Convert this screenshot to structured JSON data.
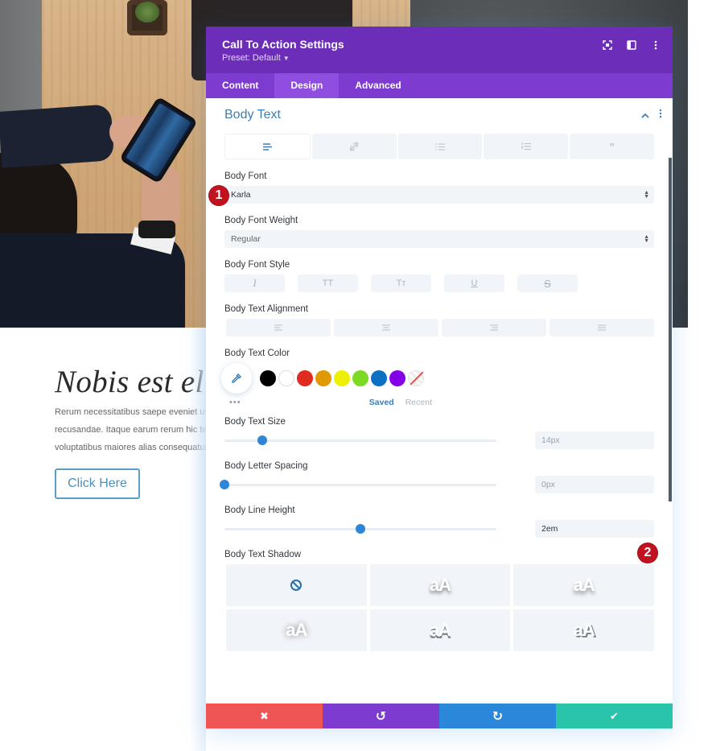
{
  "page": {
    "cta_title": "Nobis est eligendi",
    "cta_body_lines": [
      "Rerum necessitatibus saepe eveniet ut",
      "recusandae. Itaque earum rerum hic tenetur",
      "voluptatibus maiores alias consequatur"
    ],
    "cta_button": "Click Here"
  },
  "modal": {
    "title": "Call To Action Settings",
    "preset": "Preset: Default",
    "header_icons": [
      "fullscreen-icon",
      "sidebar-icon",
      "more-icon"
    ],
    "tabs": [
      {
        "label": "Content",
        "active": false
      },
      {
        "label": "Design",
        "active": true
      },
      {
        "label": "Advanced",
        "active": false
      }
    ],
    "section": {
      "title": "Body Text",
      "subtabs": [
        "paragraph-icon",
        "link-icon",
        "unordered-list-icon",
        "ordered-list-icon",
        "quote-icon"
      ],
      "active_subtab": 0
    },
    "fields": {
      "body_font": {
        "label": "Body Font",
        "value": "Karla"
      },
      "body_font_weight": {
        "label": "Body Font Weight",
        "value": "Regular"
      },
      "body_font_style": {
        "label": "Body Font Style",
        "options": [
          "I",
          "TT",
          "Tт",
          "U",
          "S"
        ]
      },
      "body_text_alignment": {
        "label": "Body Text Alignment",
        "options": [
          "left",
          "center",
          "right",
          "justify"
        ]
      },
      "body_text_color": {
        "label": "Body Text Color",
        "swatches": [
          "#000000",
          "#ffffff",
          "#e02b20",
          "#e09900",
          "#edf000",
          "#7cda24",
          "#0c71c3",
          "#8300e9",
          "none"
        ],
        "tabs": {
          "saved": "Saved",
          "recent": "Recent"
        },
        "more": "•••"
      },
      "body_text_size": {
        "label": "Body Text Size",
        "value": "14px",
        "slider_fraction": 0.14
      },
      "body_letter_spacing": {
        "label": "Body Letter Spacing",
        "value": "0px",
        "slider_fraction": 0.0
      },
      "body_line_height": {
        "label": "Body Line Height",
        "value": "2em",
        "slider_fraction": 0.5
      },
      "body_text_shadow": {
        "label": "Body Text Shadow",
        "sample": "aA",
        "presets": 6
      }
    },
    "badges": {
      "one": "1",
      "two": "2"
    },
    "footer": {
      "cancel": {
        "icon": "✖",
        "color": "#ef5555"
      },
      "undo": {
        "icon": "↺",
        "color": "#7e3bd0"
      },
      "redo": {
        "icon": "↻",
        "color": "#2b87da"
      },
      "save": {
        "icon": "✔",
        "color": "#29c4a9"
      }
    }
  },
  "colors": {
    "header": "#6c2eb9",
    "tabs": "#7d3bcf",
    "accent": "#3c7db3",
    "slider": "#2e86d6",
    "badge": "#c1121f"
  }
}
